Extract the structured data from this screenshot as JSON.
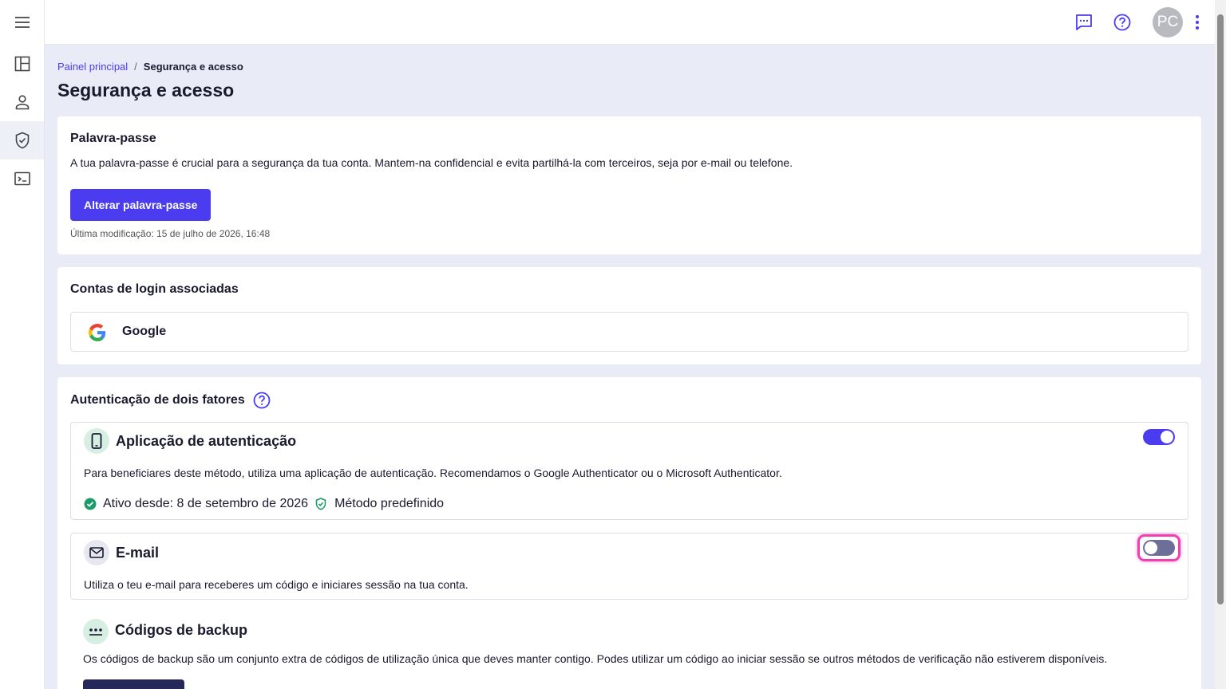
{
  "sidebar": {
    "items": [
      {
        "name": "menu-icon"
      },
      {
        "name": "dashboard-icon"
      },
      {
        "name": "person-icon"
      },
      {
        "name": "shield-icon",
        "active": true
      },
      {
        "name": "terminal-icon"
      }
    ]
  },
  "topbar": {
    "icons": [
      "chat-icon",
      "help-icon"
    ],
    "avatar_initials": "PC"
  },
  "breadcrumb": {
    "root": "Painel principal",
    "separator": "/",
    "current": "Segurança e acesso"
  },
  "page_title": "Segurança e acesso",
  "password": {
    "title": "Palavra-passe",
    "description": "A tua palavra-passe é crucial para a segurança da tua conta. Mantem-na confidencial e evita partilhá-la com terceiros, seja por e-mail ou telefone.",
    "button": "Alterar palavra-passe",
    "last_modified": "Última modificação: 15 de julho de 2026, 16:48"
  },
  "linked_accounts": {
    "title": "Contas de login associadas",
    "accounts": [
      {
        "name": "Google"
      }
    ]
  },
  "two_factor": {
    "title": "Autenticação de dois fatores",
    "methods": [
      {
        "title": "Aplicação de autenticação",
        "description": "Para beneficiares deste método, utiliza uma aplicação de autenticação. Recomendamos o Google Authenticator ou o Microsoft Authenticator.",
        "enabled": true,
        "active_since": "Ativo desde: 8 de setembro de 2026",
        "default_label": "Método predefinido"
      },
      {
        "title": "E-mail",
        "description": "Utiliza o teu e-mail para receberes um código e iniciares sessão na tua conta.",
        "enabled": false
      },
      {
        "title": "Códigos de backup",
        "description": "Os códigos de backup são um conjunto extra de códigos de utilização única que deves manter contigo. Podes utilizar um código ao iniciar sessão se outros métodos de verificação não estiverem disponíveis."
      }
    ]
  },
  "colors": {
    "accent": "#4b3cf0",
    "focus_ring": "#f23fb0",
    "success": "#1a9c6a",
    "background": "#e9ebf6"
  }
}
